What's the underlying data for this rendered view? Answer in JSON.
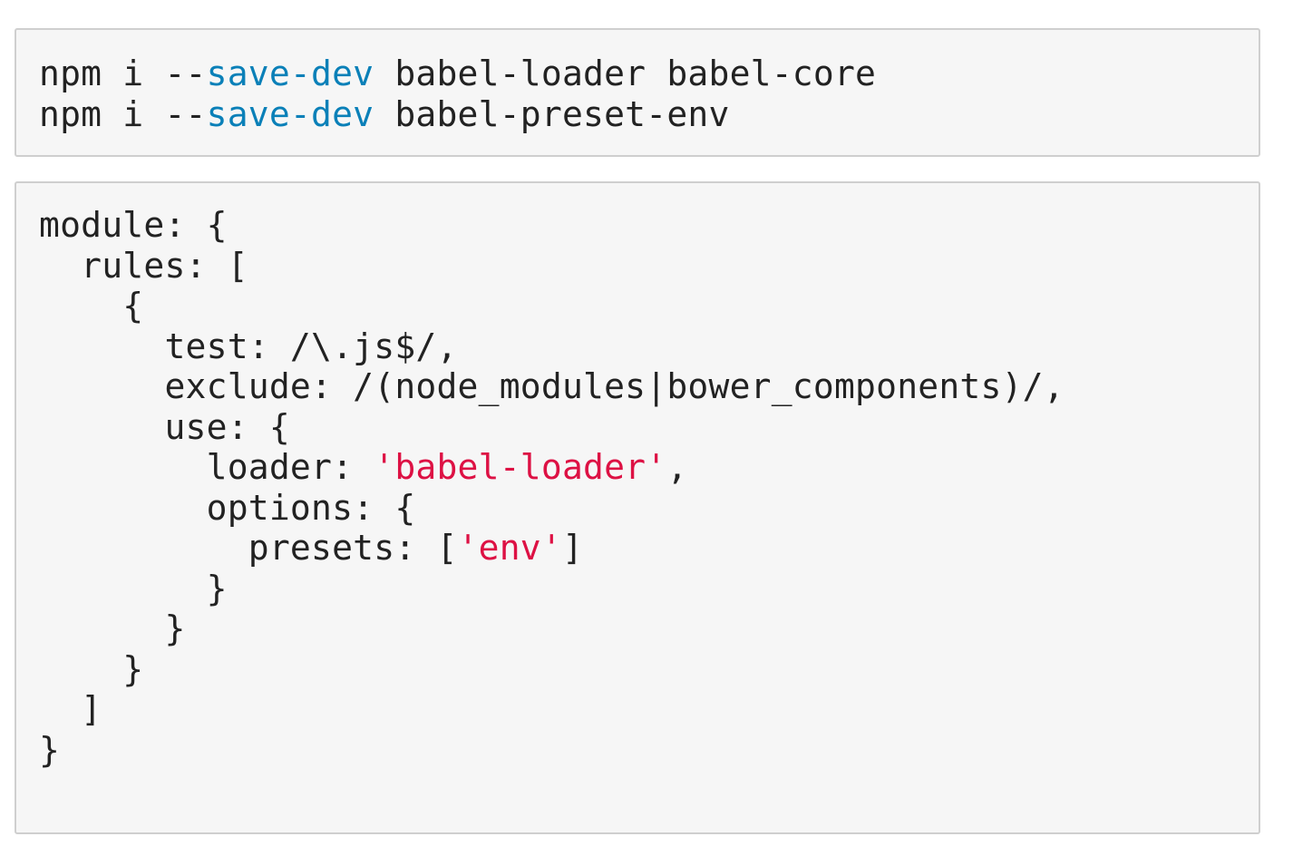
{
  "colors": {
    "background": "#f6f6f6",
    "border": "#cfcfcf",
    "text": "#222222",
    "keyword": "#0a80b8",
    "string": "#dd1144"
  },
  "install_block": {
    "lines": [
      {
        "tokens": [
          {
            "type": "plain",
            "text": "npm i --"
          },
          {
            "type": "keyword",
            "text": "save-dev"
          },
          {
            "type": "plain",
            "text": " babel-loader babel-core"
          }
        ]
      },
      {
        "tokens": [
          {
            "type": "plain",
            "text": "npm i --"
          },
          {
            "type": "keyword",
            "text": "save-dev"
          },
          {
            "type": "plain",
            "text": " babel-preset-env"
          }
        ]
      }
    ]
  },
  "config_block": {
    "lines": [
      {
        "tokens": [
          {
            "type": "plain",
            "text": "module: {"
          }
        ]
      },
      {
        "tokens": [
          {
            "type": "plain",
            "text": "  rules: ["
          }
        ]
      },
      {
        "tokens": [
          {
            "type": "plain",
            "text": "    {"
          }
        ]
      },
      {
        "tokens": [
          {
            "type": "plain",
            "text": "      test: /\\.js$/,"
          }
        ]
      },
      {
        "tokens": [
          {
            "type": "plain",
            "text": "      exclude: /(node_modules|bower_components)/,"
          }
        ]
      },
      {
        "tokens": [
          {
            "type": "plain",
            "text": "      use: {"
          }
        ]
      },
      {
        "tokens": [
          {
            "type": "plain",
            "text": "        loader: "
          },
          {
            "type": "string",
            "text": "'babel-loader'"
          },
          {
            "type": "plain",
            "text": ","
          }
        ]
      },
      {
        "tokens": [
          {
            "type": "plain",
            "text": "        options: {"
          }
        ]
      },
      {
        "tokens": [
          {
            "type": "plain",
            "text": "          presets: ["
          },
          {
            "type": "string",
            "text": "'env'"
          },
          {
            "type": "plain",
            "text": "]"
          }
        ]
      },
      {
        "tokens": [
          {
            "type": "plain",
            "text": "        }"
          }
        ]
      },
      {
        "tokens": [
          {
            "type": "plain",
            "text": "      }"
          }
        ]
      },
      {
        "tokens": [
          {
            "type": "plain",
            "text": "    }"
          }
        ]
      },
      {
        "tokens": [
          {
            "type": "plain",
            "text": "  ]"
          }
        ]
      },
      {
        "tokens": [
          {
            "type": "plain",
            "text": "}"
          }
        ]
      }
    ]
  }
}
